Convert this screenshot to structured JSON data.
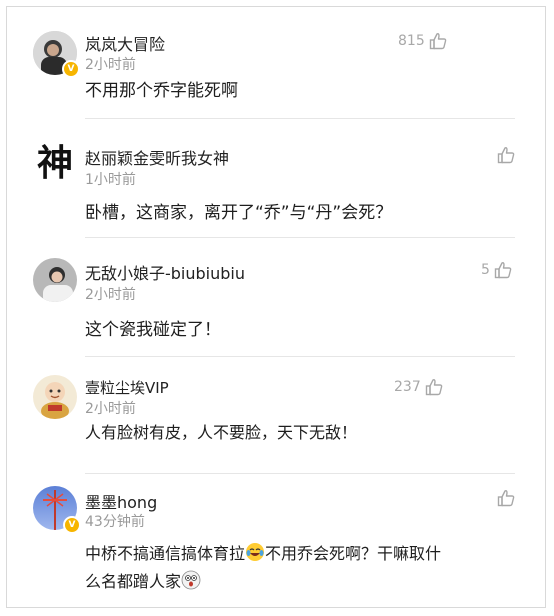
{
  "comments": [
    {
      "user": "岚岚大冒险",
      "time": "2小时前",
      "likes": "815",
      "text": "不用那个乔字能死啊",
      "avatar_icon": "user-photo-avatar",
      "verified": true
    },
    {
      "user": "赵丽颖金雯昕我女神",
      "time": "1小时前",
      "likes": "",
      "text": "卧槽，这商家，离开了“乔”与“丹”会死？",
      "avatar_icon": "calligraphy-avatar",
      "avatar_glyph": "神",
      "verified": false
    },
    {
      "user": "无敌小娘子-biubiubiu",
      "time": "2小时前",
      "likes": "5",
      "text": "这个瓷我碰定了！",
      "avatar_icon": "user-photo-avatar",
      "verified": false
    },
    {
      "user": "壹粒尘埃VIP",
      "time": "2小时前",
      "likes": "237",
      "text": "人有脸树有皮，人不要脸，天下无敌！",
      "avatar_icon": "cartoon-monk-avatar",
      "verified": false
    },
    {
      "user": "墨墨hong",
      "time": "43分钟前",
      "likes": "",
      "text_line1_a": "中桥不搞通信搞体育拉",
      "text_line1_b": "不用乔会死啊？干嘛取什",
      "text_line2_a": "么名都蹭人家",
      "emoji_1": "laughing-tears-emoji",
      "emoji_2": "shocked-face-emoji",
      "avatar_icon": "ferris-wheel-photo-avatar",
      "verified": true
    }
  ],
  "colors": {
    "verified_badge": "#f7b500",
    "meta_text": "#9a9a9a",
    "divider": "#e6e6e6"
  }
}
